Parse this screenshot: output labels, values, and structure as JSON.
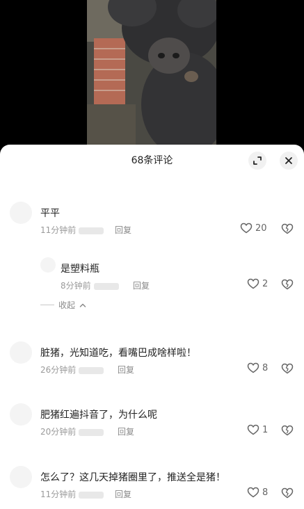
{
  "header": {
    "title": "68条评论"
  },
  "comments": [
    {
      "text": "平平",
      "time": "11分钟前",
      "reply": "回复",
      "likes": "20"
    },
    {
      "text": "是塑料瓶",
      "time": "8分钟前",
      "reply": "回复",
      "likes": "2",
      "nested": true
    },
    {
      "text": "脏猪，光知道吃，看嘴巴成啥样啦！",
      "time": "26分钟前",
      "reply": "回复",
      "likes": "8"
    },
    {
      "text": "肥猪红遍抖音了，为什么呢",
      "time": "20分钟前",
      "reply": "回复",
      "likes": "1"
    },
    {
      "text": "怎么了？这几天掉猪圈里了，推送全是猪！",
      "time": "11分钟前",
      "reply": "回复",
      "likes": "8"
    }
  ],
  "collapse": {
    "label": "收起"
  }
}
